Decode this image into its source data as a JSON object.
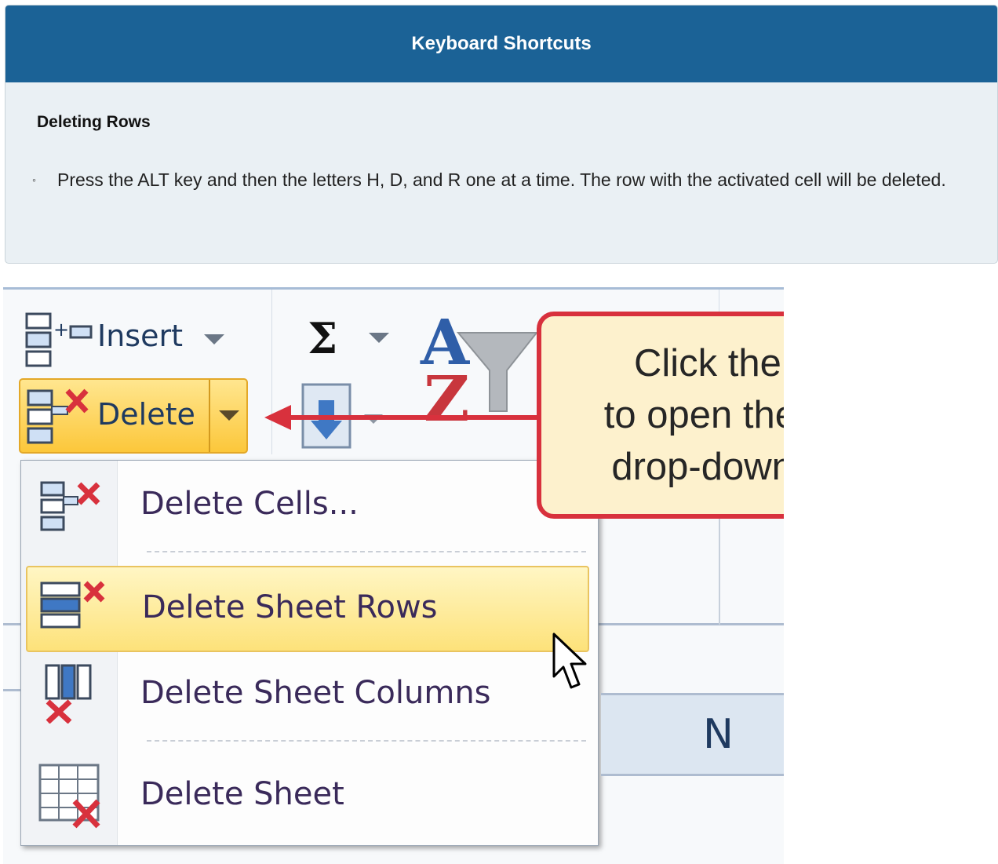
{
  "panel": {
    "title": "Keyboard Shortcuts",
    "subtitle": "Deleting Rows",
    "bullet": "Press the ALT key and then the letters H, D, and R one at a time. The row with the activated cell will be deleted."
  },
  "ribbon": {
    "insert_label": "Insert",
    "delete_label": "Delete"
  },
  "menu": {
    "items": [
      {
        "label": "Delete Cells..."
      },
      {
        "label": "Delete Sheet Rows"
      },
      {
        "label": "Delete Sheet Columns"
      },
      {
        "label": "Delete Sheet"
      }
    ]
  },
  "column_header": "N",
  "callout": {
    "line1": "Click the arrow",
    "line2": "to open the Delete",
    "line3": "drop-down menu."
  },
  "colors": {
    "header_bg": "#1b6296",
    "callout_border": "#d8313d",
    "callout_fill": "#fdf1cd",
    "highlight": "#fde27a"
  }
}
